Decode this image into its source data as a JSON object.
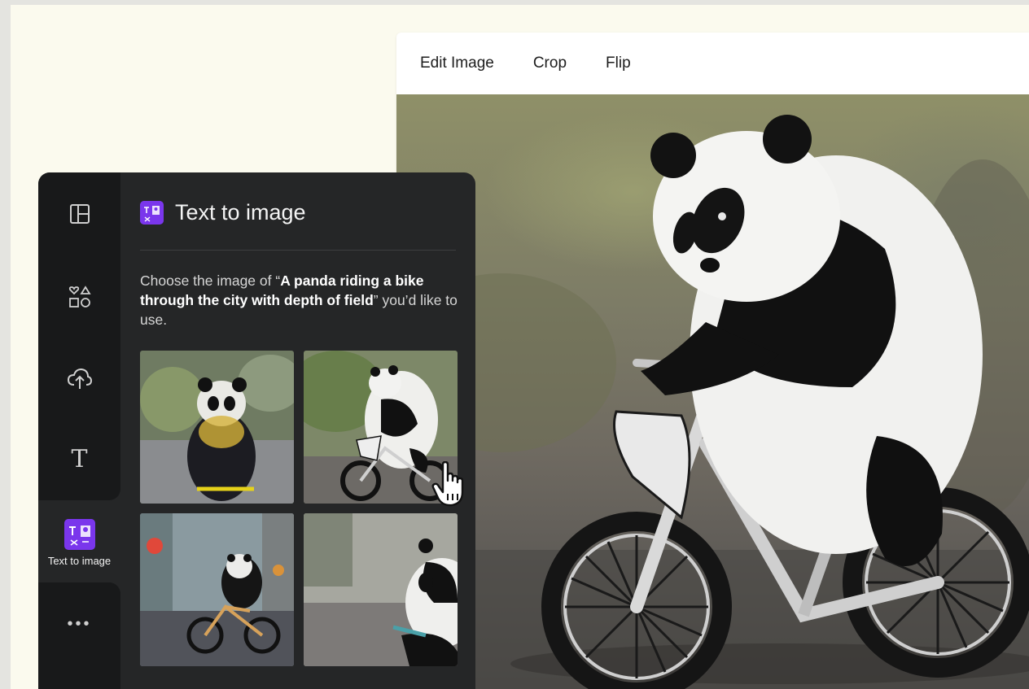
{
  "editor": {
    "toolbar": [
      {
        "label": "Edit Image",
        "name": "edit-image-button"
      },
      {
        "label": "Crop",
        "name": "crop-button"
      },
      {
        "label": "Flip",
        "name": "flip-button"
      }
    ]
  },
  "sidebar": {
    "rail": [
      {
        "icon": "layout-icon",
        "label": ""
      },
      {
        "icon": "elements-icon",
        "label": ""
      },
      {
        "icon": "cloud-upload-icon",
        "label": ""
      },
      {
        "icon": "text-icon",
        "label": ""
      },
      {
        "icon": "text-to-image-icon",
        "label": "Text to image",
        "active": true
      },
      {
        "icon": "more-icon",
        "label": ""
      }
    ]
  },
  "panel": {
    "title": "Text to image",
    "desc_prefix": "Choose the image of “",
    "desc_prompt": "A panda riding a bike through the city with depth of field",
    "desc_suffix": "” you’d like to use.",
    "results": [
      {
        "icon": "panda-image-1"
      },
      {
        "icon": "panda-image-2",
        "hovered": true
      },
      {
        "icon": "panda-image-3"
      },
      {
        "icon": "panda-image-4"
      }
    ]
  },
  "colors": {
    "panel_bg": "#252627",
    "rail_bg": "#18191a",
    "accent_purple": "#7b3cf0",
    "page_bg": "#fbfaee"
  }
}
